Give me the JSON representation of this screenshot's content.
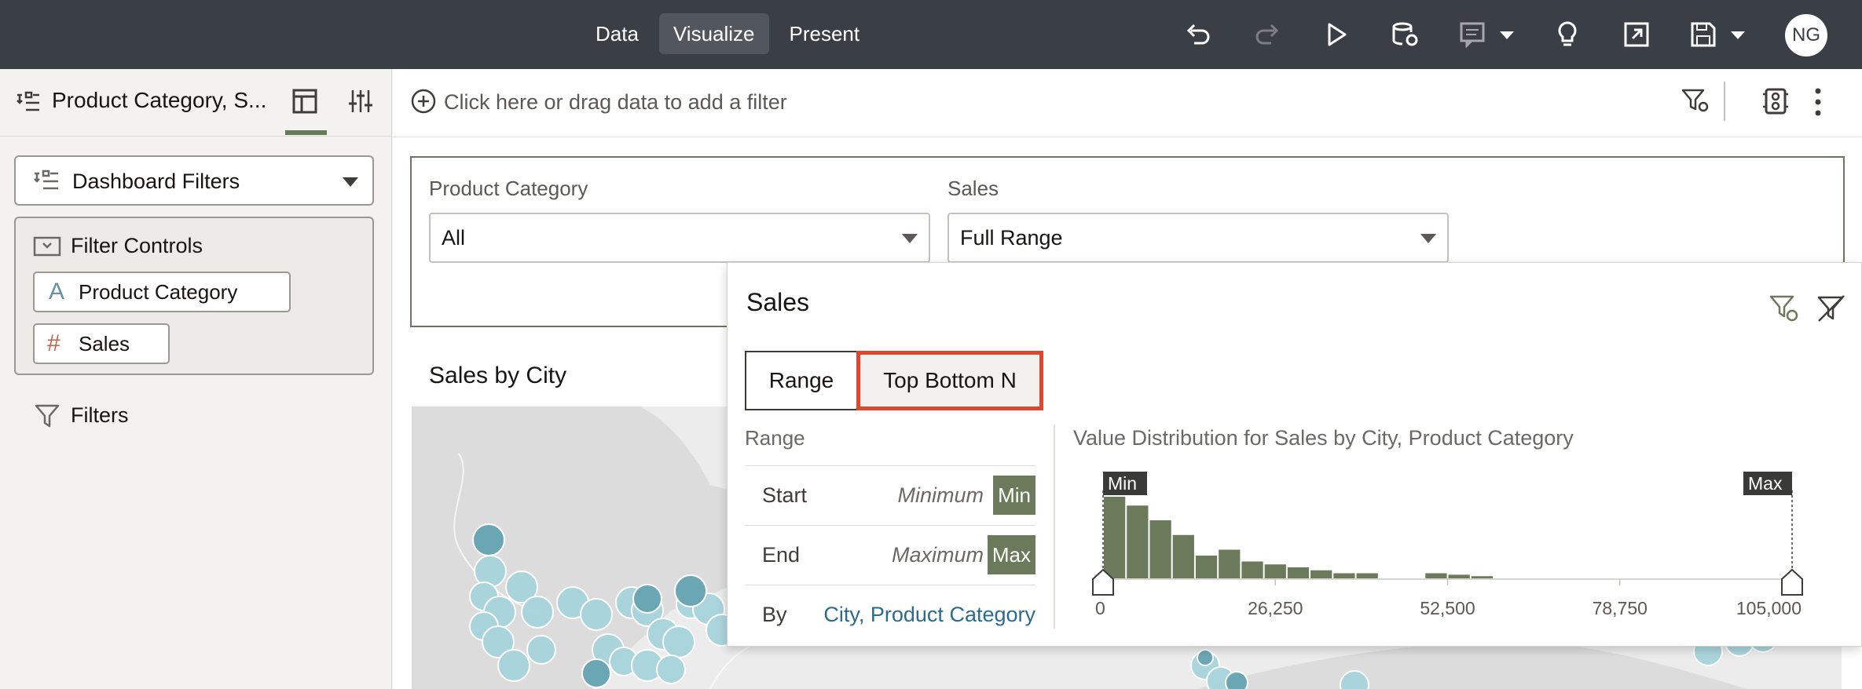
{
  "topbar": {
    "modes": [
      "Data",
      "Visualize",
      "Present"
    ],
    "active_mode": "Visualize",
    "avatar": "NG",
    "icons": [
      "undo-icon",
      "redo-icon",
      "play-icon",
      "refresh-data-icon",
      "comment-icon",
      "insights-icon",
      "export-icon",
      "save-icon"
    ]
  },
  "left_panel": {
    "title": "Product Category, S...",
    "dropdown": "Dashboard Filters",
    "filter_controls_title": "Filter Controls",
    "chips": [
      "Product Category",
      "Sales"
    ],
    "filters_label": "Filters"
  },
  "filter_bar": {
    "placeholder": "Click here or drag data to add a filter"
  },
  "canvas": {
    "fields": [
      {
        "label": "Product Category",
        "value": "All"
      },
      {
        "label": "Sales",
        "value": "Full Range"
      }
    ],
    "viz_title": "Sales by City"
  },
  "popup": {
    "title": "Sales",
    "tabs": [
      "Range",
      "Top Bottom N"
    ],
    "selected_tab": "Top Bottom N",
    "range_heading": "Range",
    "rows": [
      {
        "key": "Start",
        "value": "Minimum",
        "tag": "Min"
      },
      {
        "key": "End",
        "value": "Maximum",
        "tag": "Max"
      }
    ],
    "by_label": "By",
    "by_value": "City, Product Category",
    "dist_title": "Value Distribution for Sales by City, Product Category",
    "min_label": "Min",
    "max_label": "Max"
  },
  "chart_data": {
    "type": "bar",
    "title": "Value Distribution for Sales by City, Product Category",
    "x_ticks": [
      "0",
      "26,250",
      "52,500",
      "78,750",
      "105,000"
    ],
    "xlim": [
      0,
      105000
    ],
    "bin_width": 3500,
    "values": [
      28,
      25,
      20,
      15,
      8,
      10,
      6,
      5,
      4,
      3,
      2,
      2,
      0,
      0,
      2,
      1.5,
      1,
      0,
      0,
      0,
      0,
      0,
      0,
      0,
      0,
      0,
      0,
      0,
      0,
      0
    ],
    "bar_color": "#6b7a5a"
  }
}
